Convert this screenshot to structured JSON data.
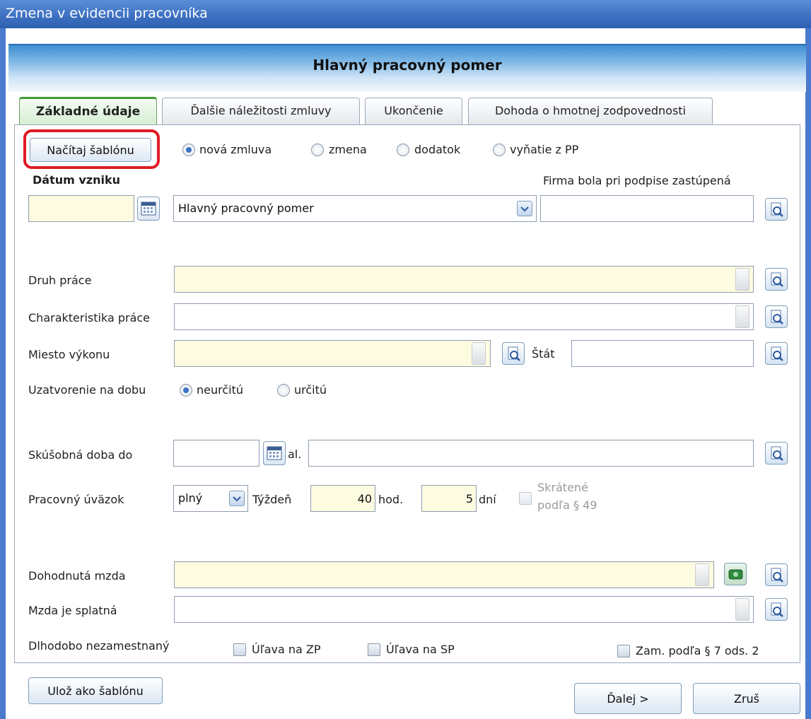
{
  "window": {
    "title": "Zmena v evidencii pracovníka"
  },
  "header": {
    "title": "Hlavný pracovný pomer"
  },
  "tabs": [
    {
      "label": "Základné údaje",
      "active": true
    },
    {
      "label": "Ďalšie náležitosti zmluvy",
      "active": false
    },
    {
      "label": "Ukončenie",
      "active": false
    },
    {
      "label": "Dohoda o hmotnej zodpovednosti",
      "active": false
    }
  ],
  "template": {
    "load_label": "Načítaj šablónu"
  },
  "contract_type": {
    "options": [
      "nová zmluva",
      "zmena",
      "dodatok",
      "vyňatie z PP"
    ],
    "selected": "nová zmluva"
  },
  "start": {
    "label": "Dátum vzniku",
    "date_value": "",
    "relation_value": "Hlavný pracovný pomer"
  },
  "representation": {
    "label": "Firma bola pri podpise zastúpená",
    "value": ""
  },
  "work": {
    "type_label": "Druh práce",
    "type_value": "",
    "characteristics_label": "Charakteristika práce",
    "characteristics_value": "",
    "place_label": "Miesto výkonu",
    "place_value": "",
    "state_label": "Štát",
    "state_value": ""
  },
  "duration": {
    "label": "Uzatvorenie na dobu",
    "options": [
      "neurčitú",
      "určitú"
    ],
    "selected": "neurčitú"
  },
  "probation": {
    "label": "Skúšobná doba do",
    "value": "",
    "al_label": "al.",
    "al_value": ""
  },
  "workload": {
    "label": "Pracovný úväzok",
    "value": "plný",
    "week_label": "Týždeň",
    "hours_value": "40",
    "hours_unit": "hod.",
    "days_value": "5",
    "days_unit": "dní",
    "shortened_line1": "Skrátené",
    "shortened_line2": "podľa § 49"
  },
  "salary": {
    "agreed_label": "Dohodnutá mzda",
    "agreed_value": "",
    "payable_label": "Mzda je splatná",
    "payable_value": ""
  },
  "flags": {
    "long_term_label": "Dlhodobo nezamestnaný",
    "zp_label": "Úľava na ZP",
    "sp_label": "Úľava na SP",
    "par7_label": "Zam. podľa § 7 ods. 2"
  },
  "footer": {
    "save_template_label": "Ulož ako šablónu",
    "next_label": "Ďalej >",
    "cancel_label": "Zruš"
  },
  "colors": {
    "required_bg": "#fdfbe0",
    "highlight": "#e01b24",
    "active_tab": "#3f9a35"
  }
}
